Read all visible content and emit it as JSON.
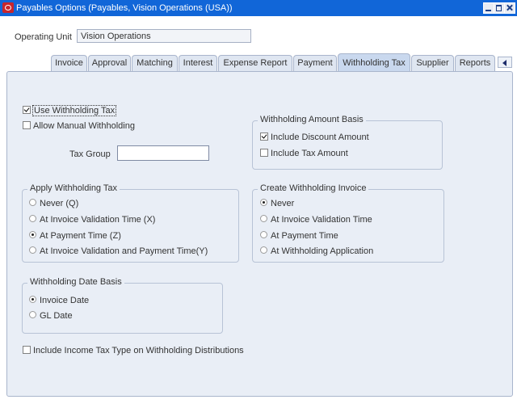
{
  "window": {
    "title": "Payables Options (Payables, Vision Operations (USA))"
  },
  "operating_unit": {
    "label": "Operating Unit",
    "value": "Vision Operations"
  },
  "tabs": [
    {
      "label": "Invoice"
    },
    {
      "label": "Approval"
    },
    {
      "label": "Matching"
    },
    {
      "label": "Interest"
    },
    {
      "label": "Expense Report"
    },
    {
      "label": "Payment"
    },
    {
      "label": "Withholding Tax",
      "active": true
    },
    {
      "label": "Supplier"
    },
    {
      "label": "Reports"
    }
  ],
  "withholding": {
    "use_withholding_tax": {
      "label": "Use Withholding Tax",
      "checked": true
    },
    "allow_manual_withholding": {
      "label": "Allow Manual Withholding",
      "checked": false
    },
    "tax_group": {
      "label": "Tax Group",
      "value": ""
    },
    "amount_basis": {
      "title": "Withholding Amount Basis",
      "include_discount_amount": {
        "label": "Include Discount Amount",
        "checked": true
      },
      "include_tax_amount": {
        "label": "Include Tax Amount",
        "checked": false
      }
    },
    "apply": {
      "title": "Apply Withholding Tax",
      "options": [
        {
          "label": "Never (Q)",
          "selected": false
        },
        {
          "label": "At Invoice Validation Time (X)",
          "selected": false
        },
        {
          "label": "At Payment Time (Z)",
          "selected": true
        },
        {
          "label": "At Invoice Validation and Payment Time(Y)",
          "selected": false
        }
      ]
    },
    "create_invoice": {
      "title": "Create Withholding Invoice",
      "options": [
        {
          "label": "Never",
          "selected": true
        },
        {
          "label": "At Invoice Validation Time",
          "selected": false
        },
        {
          "label": "At Payment Time",
          "selected": false
        },
        {
          "label": "At Withholding Application",
          "selected": false
        }
      ]
    },
    "date_basis": {
      "title": "Withholding Date Basis",
      "options": [
        {
          "label": "Invoice Date",
          "selected": true
        },
        {
          "label": "GL Date",
          "selected": false
        }
      ]
    },
    "include_income_tax_type": {
      "label": "Include Income Tax Type on Withholding Distributions",
      "checked": false
    }
  }
}
